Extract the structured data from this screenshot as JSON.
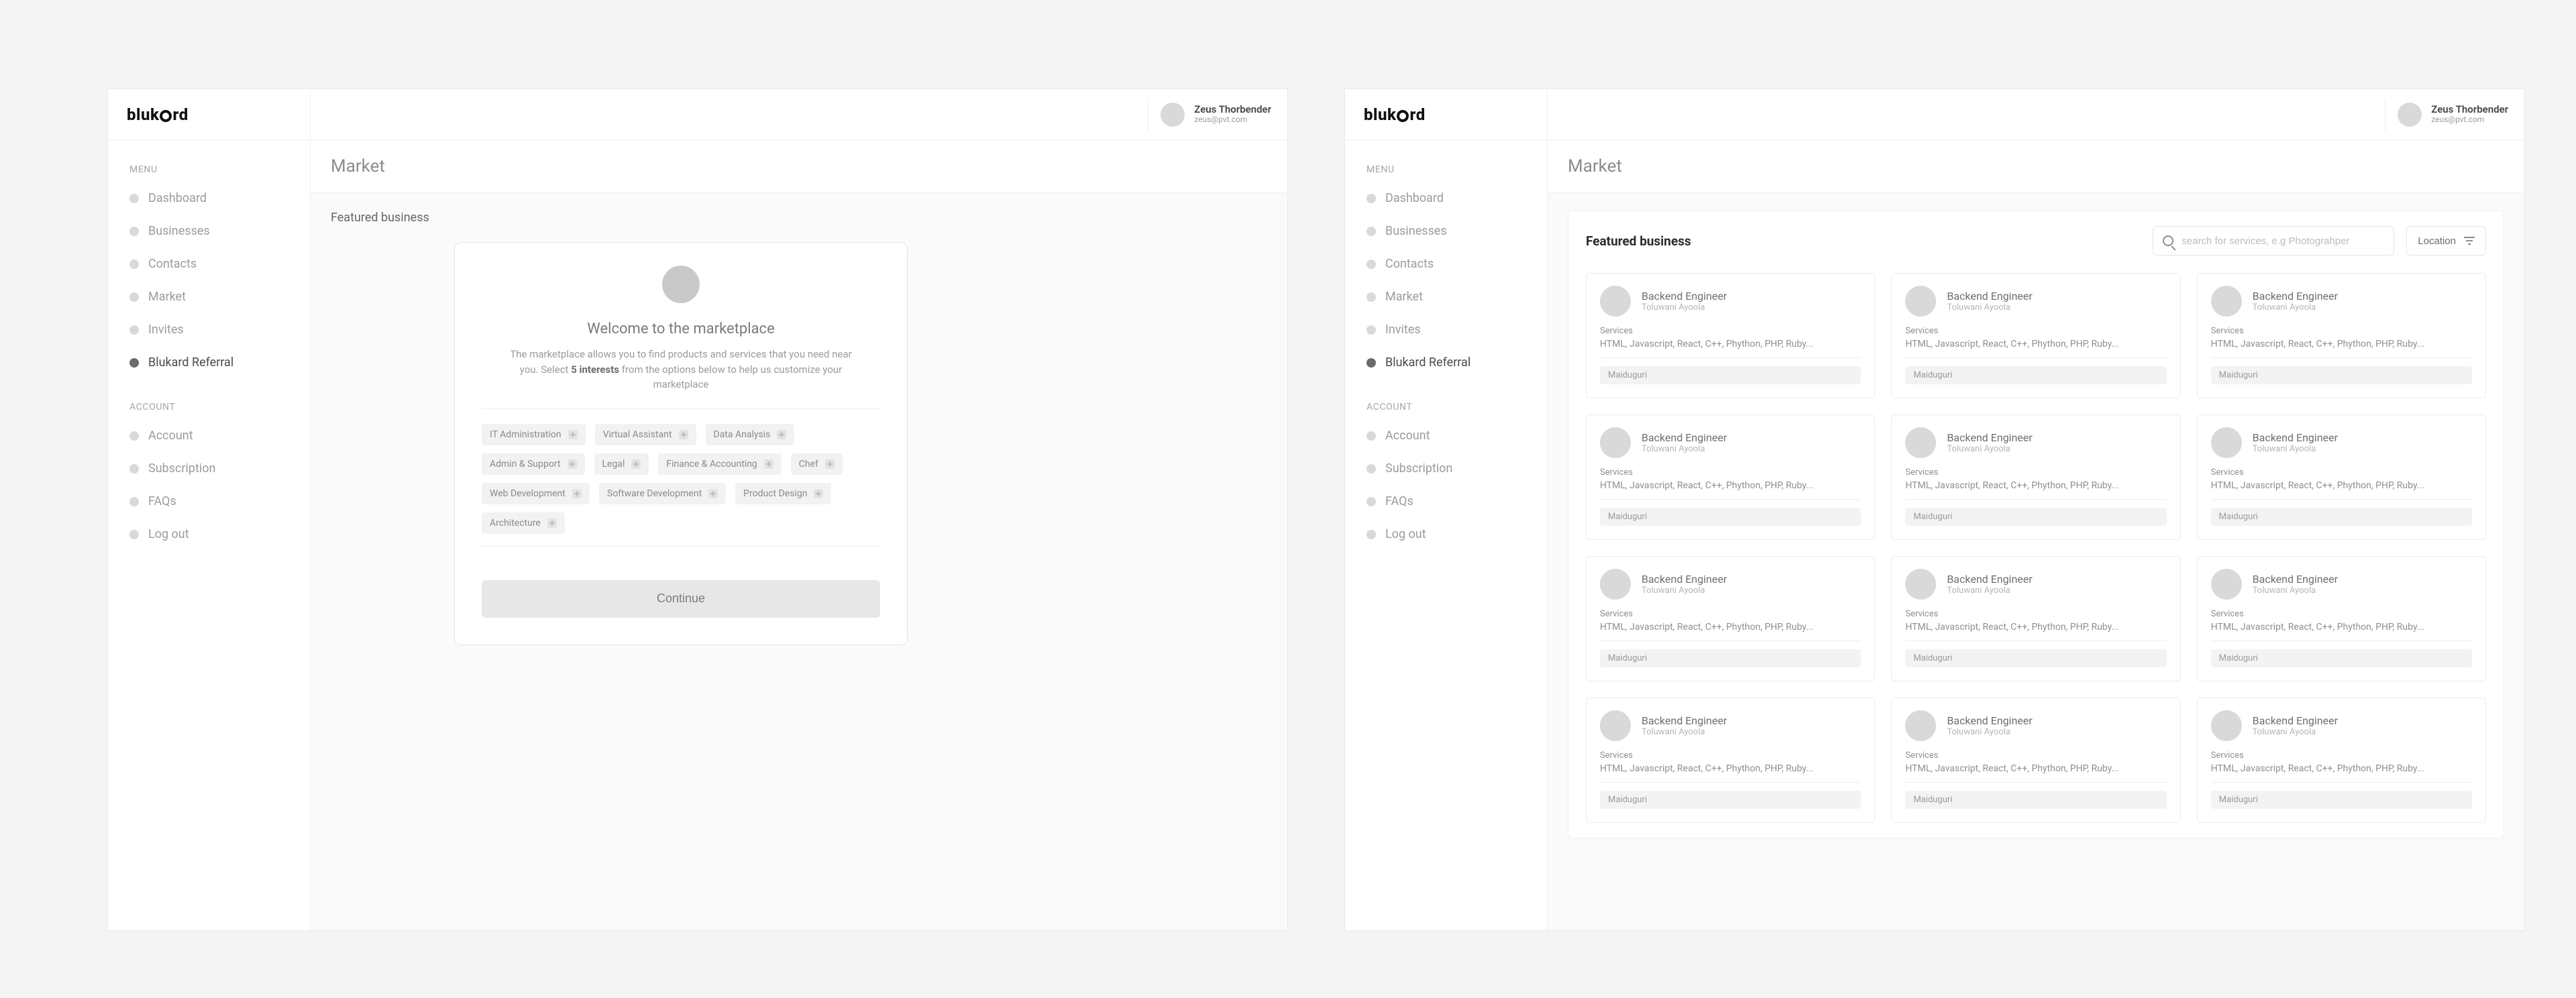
{
  "brand": {
    "pre": "bluk",
    "post": "rd"
  },
  "user": {
    "name": "Zeus Thorbender",
    "email": "zeus@pvt.com"
  },
  "page": {
    "title": "Market"
  },
  "sidebar": {
    "menu_heading": "MENU",
    "account_heading": "ACCOUNT",
    "menu": [
      {
        "label": "Dashboard"
      },
      {
        "label": "Businesses"
      },
      {
        "label": "Contacts"
      },
      {
        "label": "Market"
      },
      {
        "label": "Invites"
      },
      {
        "label": "Blukard Referral"
      }
    ],
    "account": [
      {
        "label": "Account"
      },
      {
        "label": "Subscription"
      },
      {
        "label": "FAQs"
      },
      {
        "label": "Log out"
      }
    ]
  },
  "left": {
    "section_heading": "Featured business",
    "welcome": {
      "title": "Welcome to the marketplace",
      "body_pre": "The marketplace allows you to find products and services that you need near you. Select ",
      "body_bold": "5 interests",
      "body_post": " from the options below to help us customize your marketplace",
      "interests": [
        "IT Administration",
        "Virtual Assistant",
        "Data Analysis",
        "Admin & Support",
        "Legal",
        "Finance & Accounting",
        "Chef",
        "Web Development",
        "Software Development",
        "Product Design",
        "Architecture"
      ],
      "cta": "Continue"
    }
  },
  "right": {
    "section_heading": "Featured business",
    "search": {
      "placeholder": "search for services, e.g Photograhper"
    },
    "location_label": "Location",
    "card_template": {
      "title": "Backend Engineer",
      "subtitle": "Toluwani Ayoola",
      "services_label": "Services",
      "services_text": "HTML, Javascript, React, C++, Phython, PHP, Ruby...",
      "tag": "Maiduguri"
    },
    "card_count": 12
  }
}
